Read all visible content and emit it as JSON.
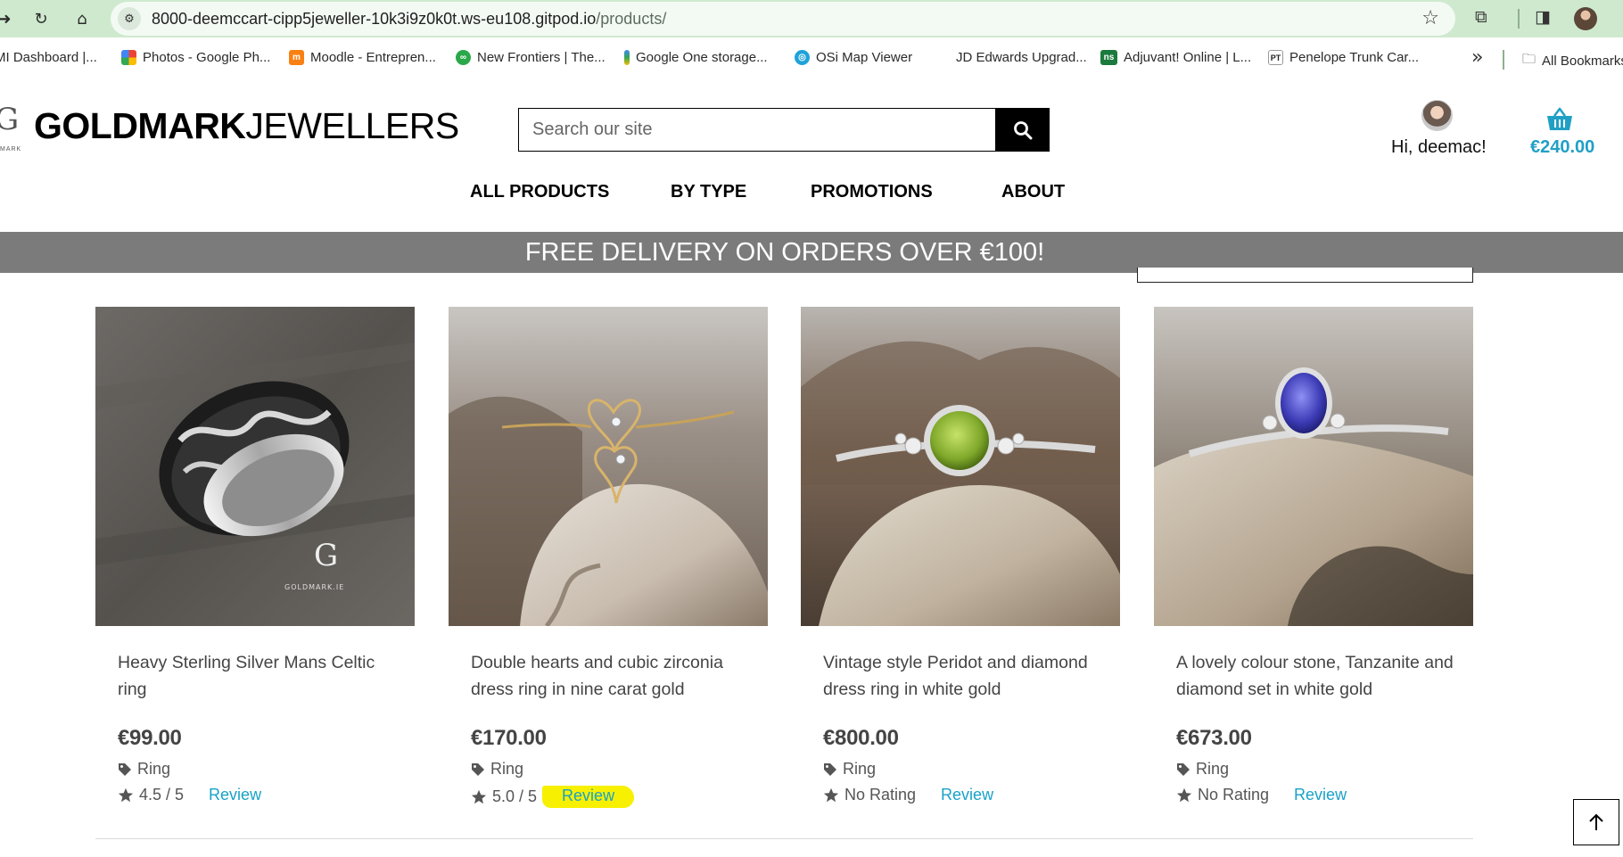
{
  "browser": {
    "url_host": "8000-deemccart-cipp5jeweller-10k3i9z0k0t.ws-eu108.gitpod.io",
    "url_path": "/products/",
    "bookmarks": [
      {
        "label": "MI Dashboard |...",
        "color": "#ffffff"
      },
      {
        "label": "Photos - Google Ph...",
        "color": "#ea4335"
      },
      {
        "label": "Moodle - Entrepren...",
        "color": "#f98012"
      },
      {
        "label": "New Frontiers | The...",
        "color": "#2aa84a"
      },
      {
        "label": "Google One storage...",
        "color": "#fbbc04"
      },
      {
        "label": "OSi Map Viewer",
        "color": "#1fa2d9"
      },
      {
        "label": "JD Edwards Upgrad...",
        "color": "#ffffff"
      },
      {
        "label": "Adjuvant! Online | L...",
        "color": "#1b7a3e"
      },
      {
        "label": "Penelope Trunk Car...",
        "color": "#ffffff"
      }
    ],
    "bookmarks_overflow": "»",
    "all_bookmarks": "All Bookmarks"
  },
  "header": {
    "brand_bold": "GOLDMARK",
    "brand_light": "JEWELLERS",
    "logo_letter": "G",
    "logo_sub": "MARK",
    "search_placeholder": "Search our site",
    "greeting": "Hi, deemac!",
    "cart_total": "€240.00",
    "nav": [
      "ALL PRODUCTS",
      "BY TYPE",
      "PROMOTIONS",
      "ABOUT"
    ]
  },
  "promo": {
    "text": "FREE DELIVERY ON ORDERS OVER €100!"
  },
  "products": [
    {
      "title": "Heavy Sterling Silver Mans Celtic ring",
      "price": "€99.00",
      "category": "Ring",
      "rating": "4.5 / 5",
      "review_label": "Review",
      "image": "celtic-silver-ring"
    },
    {
      "title": "Double hearts and cubic zirconia dress ring in nine carat gold",
      "price": "€170.00",
      "category": "Ring",
      "rating": "5.0 / 5",
      "review_label": "Review",
      "image": "double-hearts-gold-ring"
    },
    {
      "title": "Vintage style Peridot and diamond dress ring in white gold",
      "price": "€800.00",
      "category": "Ring",
      "rating": "No Rating",
      "review_label": "Review",
      "image": "peridot-white-gold-ring"
    },
    {
      "title": "A lovely colour stone, Tanzanite and diamond set in white gold",
      "price": "€673.00",
      "category": "Ring",
      "rating": "No Rating",
      "review_label": "Review",
      "image": "tanzanite-white-gold-ring"
    }
  ],
  "colors": {
    "accent": "#18a2c7",
    "promo_bar": "#7b7b7b",
    "highlight": "#f7f000"
  }
}
